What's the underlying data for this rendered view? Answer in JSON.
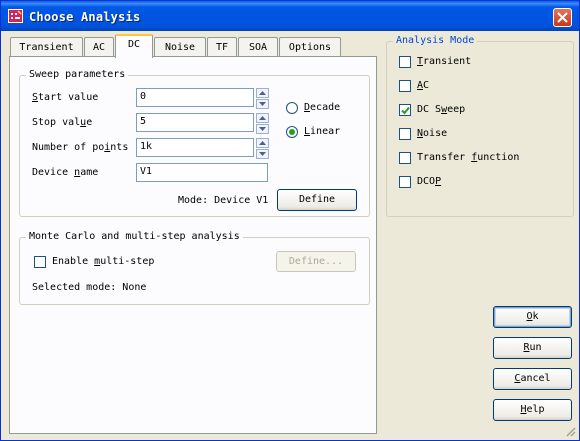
{
  "window": {
    "title": "Choose Analysis"
  },
  "tabs": [
    {
      "label": "Transient",
      "active": false
    },
    {
      "label": "AC",
      "active": false
    },
    {
      "label": "DC",
      "active": true
    },
    {
      "label": "Noise",
      "active": false
    },
    {
      "label": "TF",
      "active": false
    },
    {
      "label": "SOA",
      "active": false
    },
    {
      "label": "Options",
      "active": false
    }
  ],
  "sweep": {
    "group_title": "Sweep parameters",
    "start_label_u": "S",
    "start_label_rest": "tart value",
    "start_value": "0",
    "stop_label_pre": "Stop val",
    "stop_label_u": "u",
    "stop_label_post": "e",
    "stop_value": "5",
    "points_label_pre": "Number of po",
    "points_label_u": "i",
    "points_label_post": "nts",
    "points_value": "1k",
    "device_label_pre": "Device ",
    "device_label_u": "n",
    "device_label_post": "ame",
    "device_value": "V1",
    "decade_u": "D",
    "decade_rest": "ecade",
    "linear_u": "L",
    "linear_rest": "inear",
    "selected_scale": "Linear",
    "mode_text": "Mode: Device V1",
    "define_label": "Define"
  },
  "monte": {
    "group_title": "Monte Carlo and multi-step analysis",
    "enable_pre": "Enable ",
    "enable_u": "m",
    "enable_post": "ulti-step",
    "enable_checked": false,
    "define_label": "Define...",
    "selected_mode": "Selected mode: None"
  },
  "analysis_mode": {
    "group_title": "Analysis Mode",
    "items": [
      {
        "u": "T",
        "rest": "ransient",
        "checked": false
      },
      {
        "u": "A",
        "rest": "C",
        "checked": false
      },
      {
        "pre": "DC S",
        "u": "w",
        "rest": "eep",
        "checked": true
      },
      {
        "u": "N",
        "rest": "oise",
        "checked": false
      },
      {
        "pre": "Transfer ",
        "u": "f",
        "rest": "unction",
        "checked": false
      },
      {
        "pre": "DCO",
        "u": "P",
        "rest": "",
        "checked": false
      }
    ]
  },
  "buttons": {
    "ok_u": "O",
    "ok_rest": "k",
    "run_u": "R",
    "run_rest": "un",
    "cancel_u": "C",
    "cancel_rest": "ancel",
    "help_u": "H",
    "help_rest": "elp"
  },
  "colors": {
    "titlebar": "#0055E5",
    "dialog_bg": "#ECE9D8",
    "tab_active_accent": "#FFC83C",
    "check_green": "#21A121",
    "group_title_blue": "#0046D5"
  }
}
